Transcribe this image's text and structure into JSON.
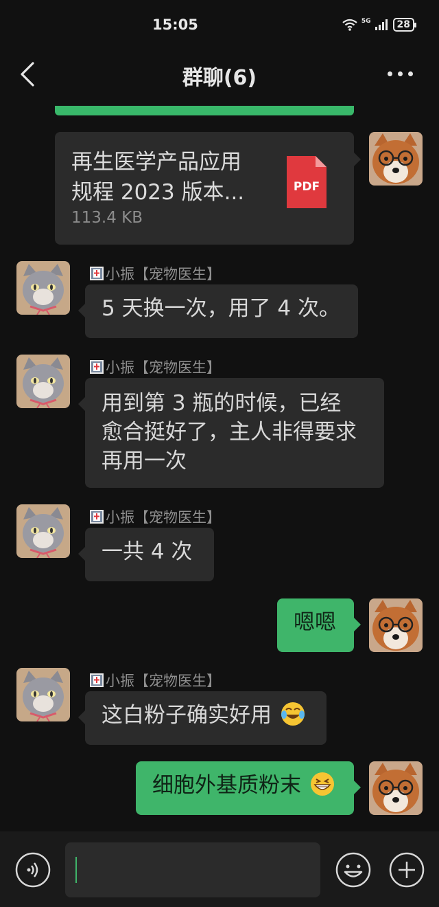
{
  "status_bar": {
    "time": "15:05",
    "network": "5G",
    "battery": "28"
  },
  "nav": {
    "title": "群聊(6)"
  },
  "file_message": {
    "name_line1": "再生医学产品应用",
    "name_line2": "规程 2023 版本...",
    "size": "113.4 KB",
    "type_label": "PDF"
  },
  "sender_name": "小振【宠物医生】",
  "messages": {
    "m1": "5 天换一次，用了 4 次。",
    "m2_line1": "用到第 3 瓶的时候，已经",
    "m2_line2": "愈合挺好了，主人非得要求",
    "m2_line3": "再用一次",
    "m3": "一共 4 次",
    "m4": "嗯嗯",
    "m5": "这白粉子确实好用",
    "m6": "细胞外基质粉末"
  },
  "icons": {
    "back": "back-arrow-icon",
    "more": "more-dots-icon",
    "voice": "voice-icon",
    "emoji": "emoji-icon",
    "plus": "plus-icon"
  },
  "colors": {
    "green_bubble": "#3fb56a",
    "gray_bubble": "#2b2b2b",
    "background": "#111111",
    "pdf_red": "#e0393e"
  }
}
